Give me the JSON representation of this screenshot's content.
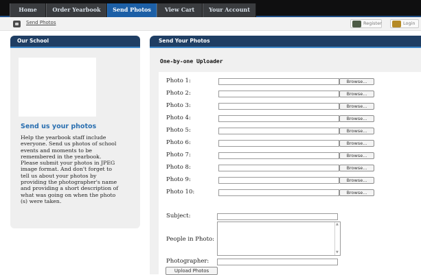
{
  "nav": {
    "tabs": [
      {
        "label": "Home",
        "active": false
      },
      {
        "label": "Order Yearbook",
        "active": false
      },
      {
        "label": "Send Photos",
        "active": true
      },
      {
        "label": "View Cart",
        "active": false
      },
      {
        "label": "Your Account",
        "active": false
      }
    ]
  },
  "breadcrumb": {
    "current": "Send Photos"
  },
  "account_links": {
    "register": "Register",
    "login": "Login"
  },
  "sidebar": {
    "header": "Our School",
    "title": "Send us your photos",
    "body_lines": [
      "Help the yearbook staff include",
      "everyone. Send us photos of school",
      "events and moments to be",
      "remembered in the yearbook.",
      "Please submit your photos in JPEG",
      "image format. And don't forget to",
      "tell us about your photos by",
      "providing the photographer's name",
      "and providing a short description of",
      "what was going on when the photo",
      "(s) were taken."
    ]
  },
  "main": {
    "header": "Send Your Photos",
    "subheader": "One-by-one Uploader",
    "photo_fields": [
      {
        "label": "Photo 1:",
        "browse": "Browse..."
      },
      {
        "label": "Photo 2:",
        "browse": "Browse..."
      },
      {
        "label": "Photo 3:",
        "browse": "Browse..."
      },
      {
        "label": "Photo 4:",
        "browse": "Browse..."
      },
      {
        "label": "Photo 5:",
        "browse": "Browse..."
      },
      {
        "label": "Photo 6:",
        "browse": "Browse..."
      },
      {
        "label": "Photo 7:",
        "browse": "Browse..."
      },
      {
        "label": "Photo 8:",
        "browse": "Browse..."
      },
      {
        "label": "Photo 9:",
        "browse": "Browse..."
      },
      {
        "label": "Photo 10:",
        "browse": "Browse..."
      }
    ],
    "subject_label": "Subject:",
    "subject_value": "",
    "people_label": "People in Photo:",
    "people_value": "",
    "photographer_label": "Photographer:",
    "photographer_value": "",
    "upload_label": "Upload Photos"
  }
}
